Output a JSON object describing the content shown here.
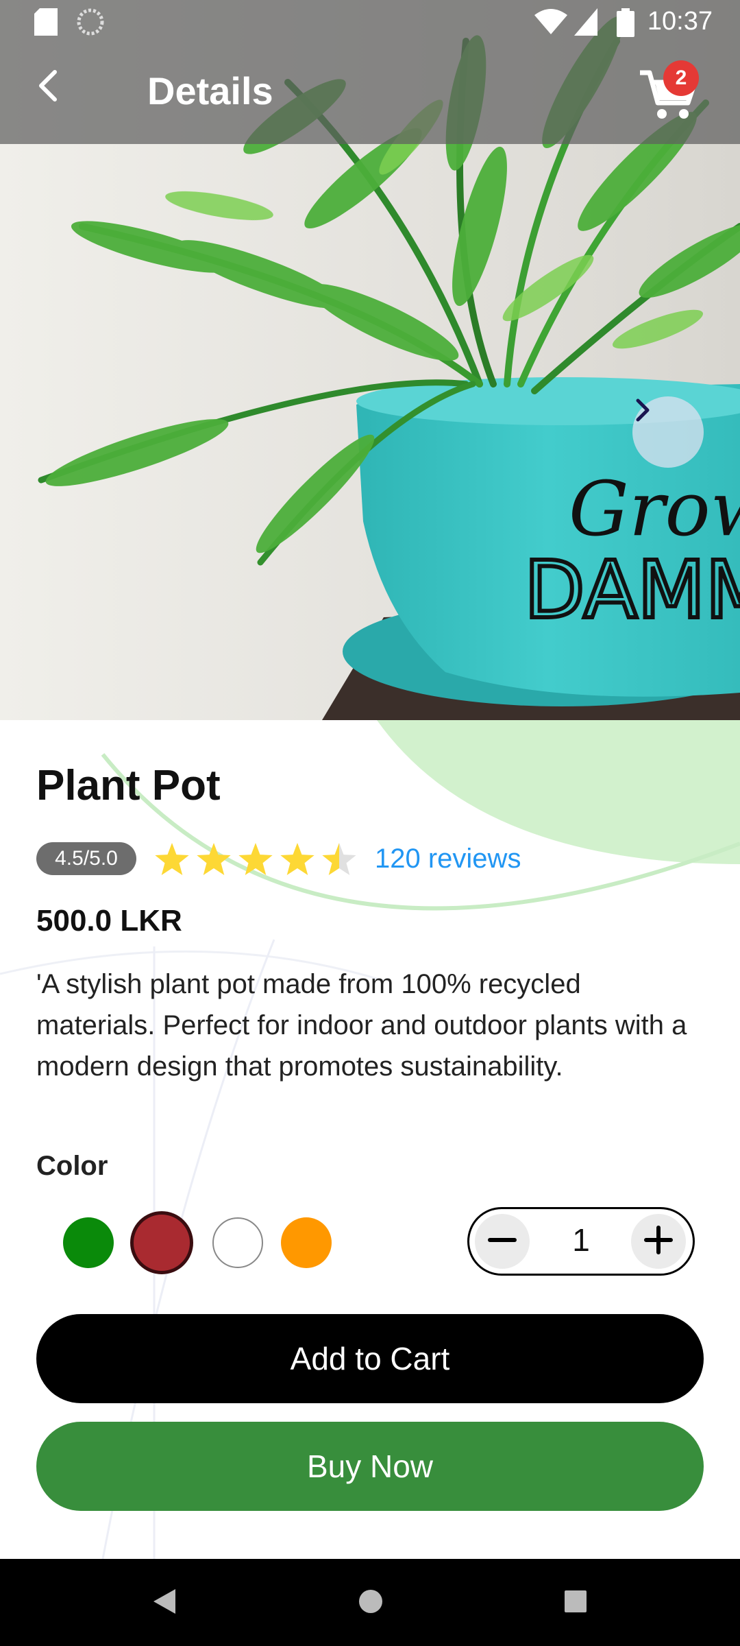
{
  "status_bar": {
    "time": "10:37",
    "icons": [
      "sd-card-icon",
      "loading-icon",
      "wifi-icon",
      "signal-icon",
      "battery-icon"
    ]
  },
  "app_bar": {
    "title": "Details",
    "back_icon": "back-arrow-icon",
    "cart_icon": "cart-icon",
    "cart_count": "2"
  },
  "product": {
    "name": "Plant Pot",
    "rating_text": "4.5/5.0",
    "rating_value": 4.5,
    "rating_max": 5,
    "reviews": "120 reviews",
    "price": "500.0 LKR",
    "description": "'A stylish plant pot made from 100% recycled materials. Perfect for indoor and outdoor plants with a modern design that promotes sustainability.",
    "image_text": "Grow DAMMIT"
  },
  "colors": {
    "label": "Color",
    "options": [
      "#0a8a0a",
      "#a92a30",
      "#ffffff",
      "#ff9800"
    ],
    "selected_index": 1
  },
  "quantity": {
    "value": "1"
  },
  "actions": {
    "add_to_cart": "Add to Cart",
    "buy_now": "Buy Now"
  },
  "theme": {
    "accent_green": "#388e3c",
    "link_blue": "#2196f3",
    "star_yellow": "#fdd835",
    "badge_red": "#e53935"
  }
}
